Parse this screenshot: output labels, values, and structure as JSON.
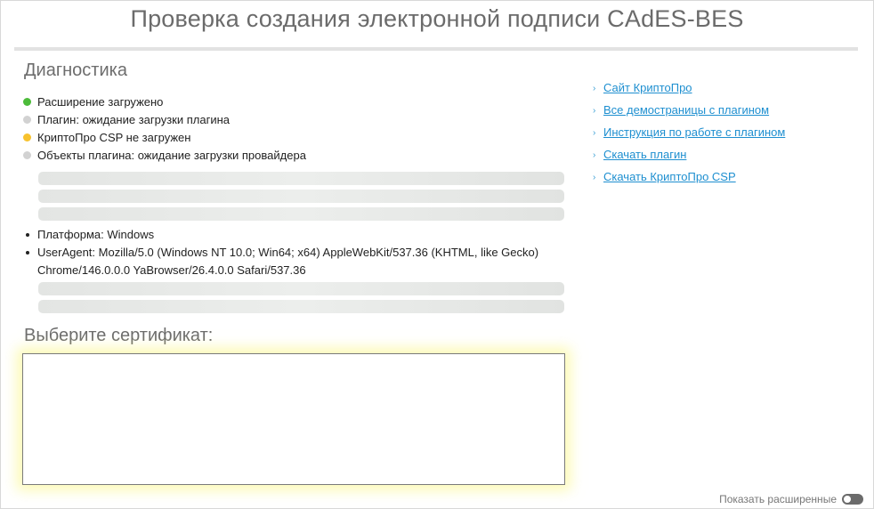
{
  "page": {
    "title": "Проверка создания электронной подписи CAdES-BES"
  },
  "diagnostics": {
    "title": "Диагностика",
    "items": [
      {
        "label": "Расширение загружено",
        "status": "ok",
        "color": "#4cbb3a"
      },
      {
        "label": "Плагин: ожидание загрузки плагина",
        "status": "pending",
        "color": "#d2d2d2"
      },
      {
        "label": "КриптоПро CSP не загружен",
        "status": "warning",
        "color": "#f7c22e"
      },
      {
        "label": "Объекты плагина: ожидание загрузки провайдера",
        "status": "pending",
        "color": "#d2d2d2"
      }
    ]
  },
  "system_info": {
    "items": [
      {
        "text": "Платформа: Windows"
      },
      {
        "text": "UserAgent: Mozilla/5.0 (Windows NT 10.0; Win64; x64) AppleWebKit/537.36 (KHTML, like Gecko) Chrome/146.0.0.0 YaBrowser/26.4.0.0 Safari/537.36"
      }
    ]
  },
  "certificate": {
    "title": "Выберите сертификат:"
  },
  "links": [
    {
      "label": "Сайт КриптоПро"
    },
    {
      "label": "Все демостраницы с плагином"
    },
    {
      "label": "Инструкция по работе с плагином"
    },
    {
      "label": "Скачать плагин"
    },
    {
      "label": "Скачать КриптоПро CSP"
    }
  ],
  "advanced": {
    "label": "Показать расширенные",
    "enabled": false
  },
  "colors": {
    "link": "#1e8fd0",
    "ok": "#4cbb3a",
    "warning": "#f7c22e",
    "pending": "#d2d2d2"
  }
}
